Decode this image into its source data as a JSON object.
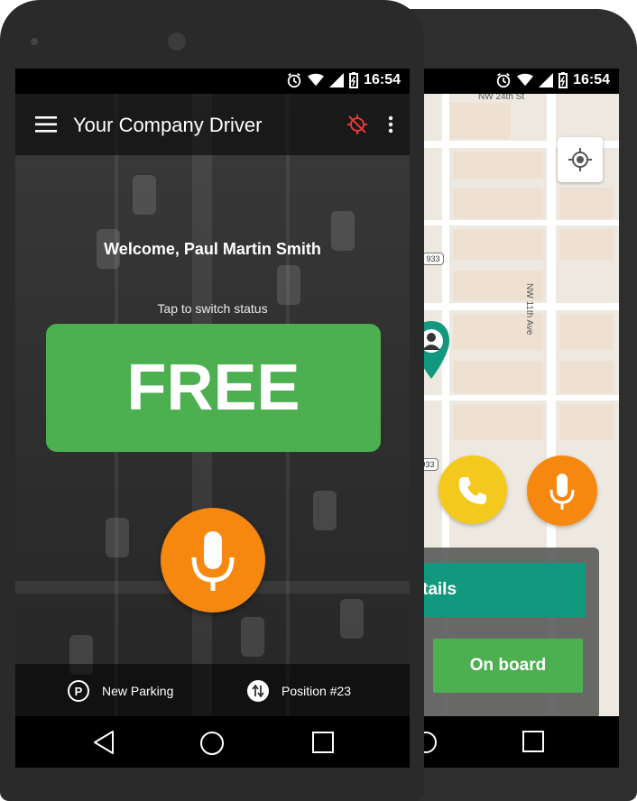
{
  "status_bar": {
    "time": "16:54"
  },
  "main_screen": {
    "app_title": "Your Company Driver",
    "welcome_text": "Welcome, Paul Martin Smith",
    "tap_hint": "Tap to switch status",
    "status_button_label": "FREE",
    "bottom_bar": {
      "parking_label": "New Parking",
      "parking_icon_letter": "P",
      "position_label": "Position #23"
    },
    "icons": [
      "menu-icon",
      "gps-off-icon",
      "more-vert-icon",
      "mic-icon",
      "parking-icon",
      "swap-vert-icon"
    ]
  },
  "map_screen": {
    "street_labels": [
      "NW 24th St",
      "NW 11th Ave"
    ],
    "route_shields": [
      "933",
      "933",
      "933"
    ],
    "details_button_label": "tails",
    "onboard_button_label": "On board",
    "icons": [
      "my-location-icon",
      "driver-pin-icon",
      "phone-icon",
      "mic-icon"
    ]
  },
  "navigation_bar": {
    "icons": [
      "back-icon",
      "home-icon",
      "recents-icon"
    ]
  },
  "colors": {
    "free_green": "#4caf50",
    "mic_orange": "#f7880f",
    "call_yellow": "#f4c91e",
    "details_teal": "#12987f",
    "gps_off_red": "#e53935"
  }
}
